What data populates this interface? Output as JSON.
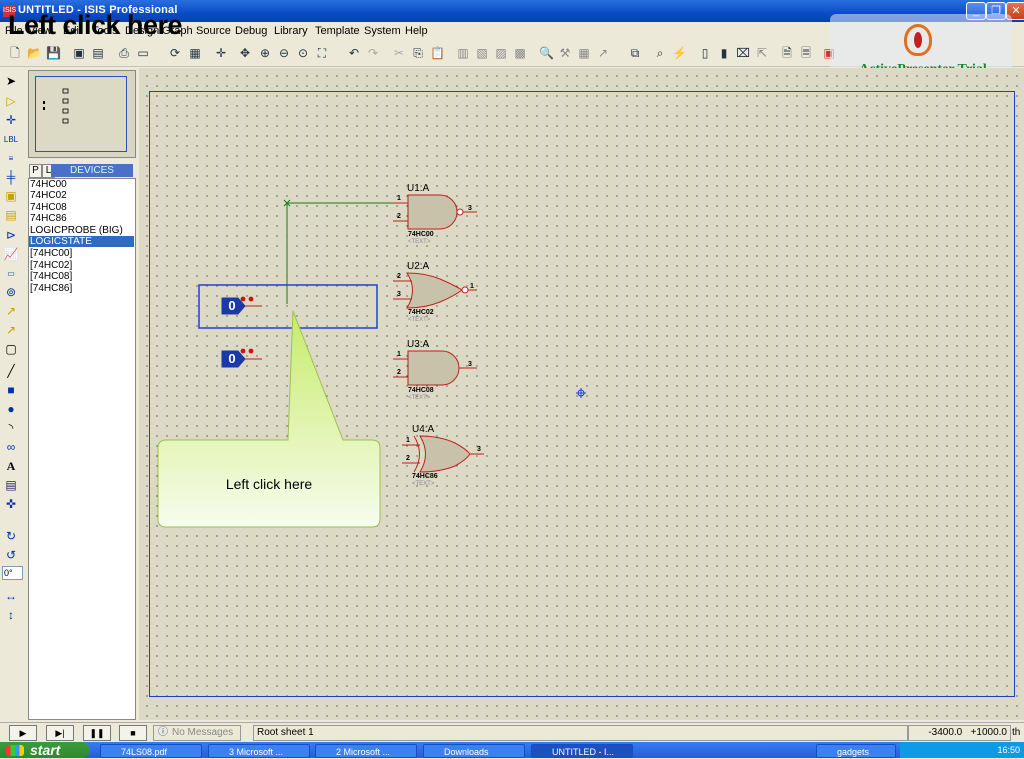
{
  "window": {
    "title": "UNTITLED - ISIS Professional",
    "app_icon": "ISIS"
  },
  "caption": "Left click here",
  "menu": {
    "items": [
      "File",
      "View",
      "Edit",
      "Tools",
      "Design",
      "Graph",
      "Source",
      "Debug",
      "Library",
      "Template",
      "System",
      "Help"
    ]
  },
  "watermark": {
    "text": "ActivePresenter Trial"
  },
  "devices": {
    "tab_p": "P",
    "tab_l": "L",
    "header": "DEVICES",
    "items": [
      "74HC00",
      "74HC02",
      "74HC08",
      "74HC86",
      "LOGICPROBE (BIG)",
      "LOGICSTATE",
      "[74HC00]",
      "[74HC02]",
      "[74HC08]",
      "[74HC86]"
    ],
    "selected_index": 5
  },
  "left_tools": {
    "angle": "0°"
  },
  "schematic": {
    "gates": [
      {
        "ref": "U1:A",
        "part": "74HC00",
        "text": "<TEXT>",
        "pins": [
          "1",
          "2",
          "3"
        ],
        "type": "nand"
      },
      {
        "ref": "U2:A",
        "part": "74HC02",
        "text": "<TEXT>",
        "pins": [
          "2",
          "3",
          "1"
        ],
        "type": "nor"
      },
      {
        "ref": "U3:A",
        "part": "74HC08",
        "text": "<TEXT>",
        "pins": [
          "1",
          "2",
          "3"
        ],
        "type": "and"
      },
      {
        "ref": "U4:A",
        "part": "74HC86",
        "text": "<TEXT>",
        "pins": [
          "1",
          "2",
          "3"
        ],
        "type": "xor"
      }
    ],
    "logic_states": [
      {
        "value": "0"
      },
      {
        "value": "0"
      }
    ]
  },
  "callout": {
    "text": "Left click here"
  },
  "status": {
    "messages": "No Messages",
    "sheet": "Root sheet 1",
    "coords": "-3400.0   +1000.0",
    "units": "th"
  },
  "taskbar": {
    "start": "start",
    "tasks": [
      "74LS08.pdf",
      "3 Microsoft ...",
      "2 Microsoft ...",
      "Downloads",
      "UNTITLED - I..."
    ],
    "tray_extra": "gadgets",
    "clock": "16:50"
  },
  "colors": {
    "accent": "#316ac5",
    "gate_fill": "#c8c2aa",
    "gate_stroke": "#c02020",
    "wire": "#1a7a1a",
    "selection": "#2040e0",
    "callout": "#d8f0a0"
  }
}
